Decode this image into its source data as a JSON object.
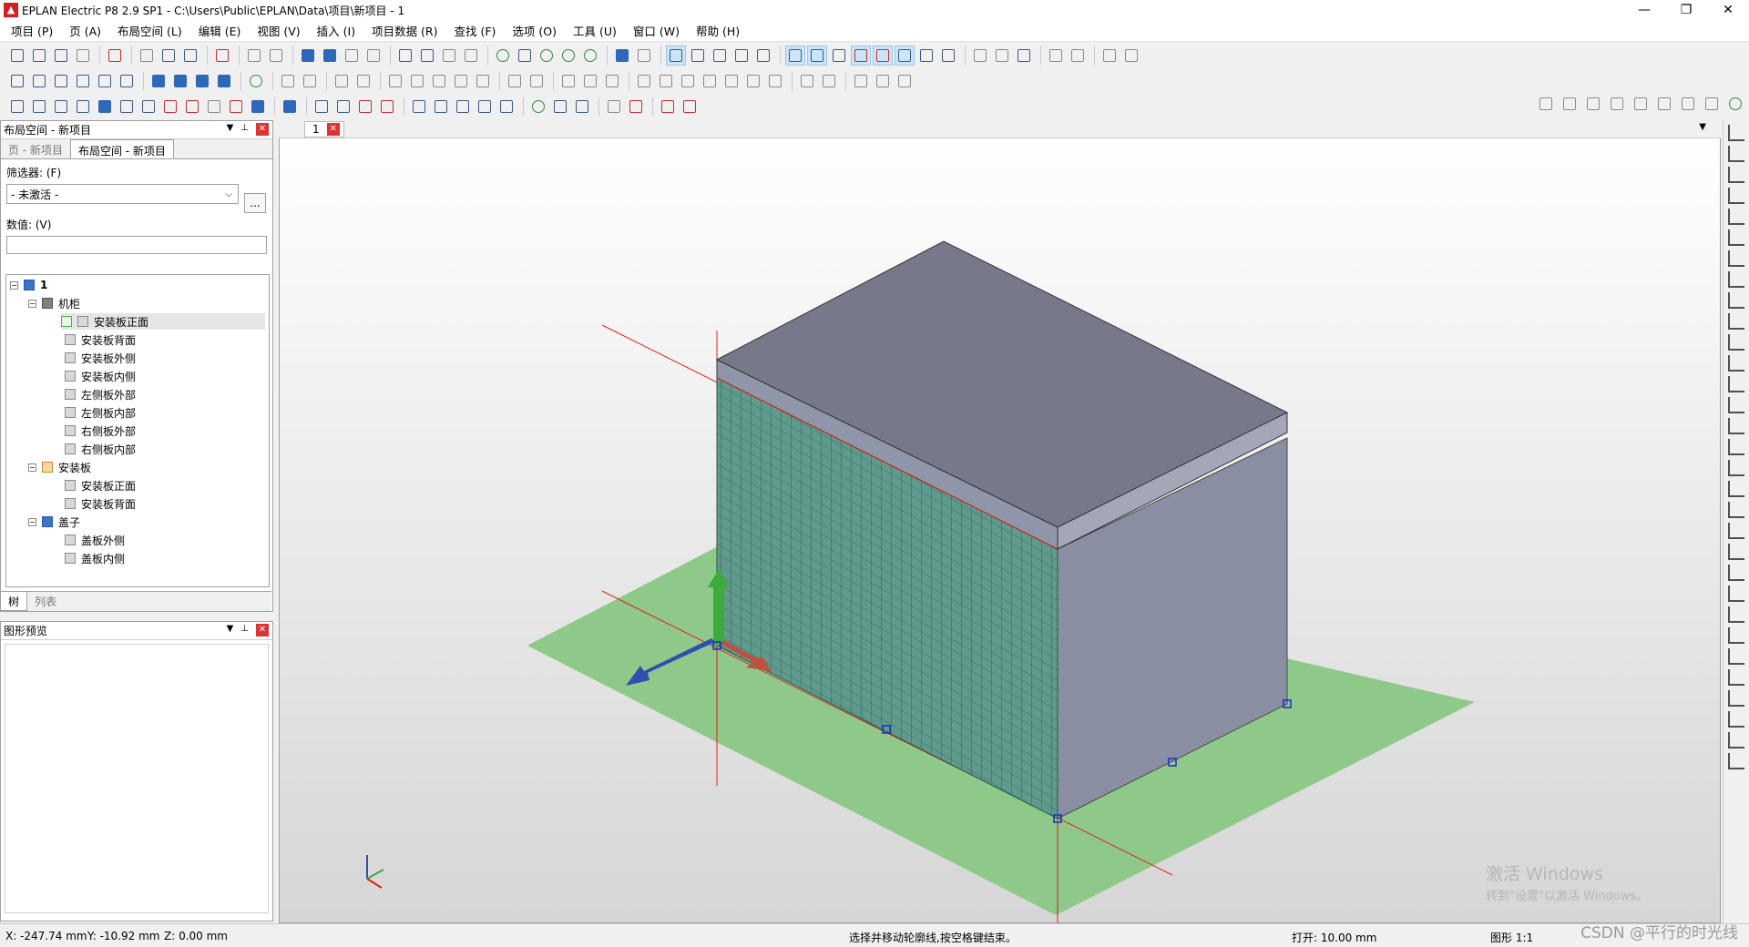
{
  "window": {
    "title": "EPLAN Electric P8 2.9 SP1 - C:\\Users\\Public\\EPLAN\\Data\\项目\\新项目 - 1"
  },
  "menu": [
    "项目 (P)",
    "页 (A)",
    "布局空间 (L)",
    "编辑 (E)",
    "视图 (V)",
    "插入 (I)",
    "项目数据 (R)",
    "查找 (F)",
    "选项 (O)",
    "工具 (U)",
    "窗口 (W)",
    "帮助 (H)"
  ],
  "layout_panel": {
    "title": "布局空间 - 新项目",
    "tabs": [
      "页 - 新项目",
      "布局空间 - 新项目"
    ],
    "filter_label": "筛选器: (F)",
    "filter_value": "- 未激活 -",
    "filter_button": "...",
    "value_label": "数值: (V)",
    "bottom_tabs": [
      "树",
      "列表"
    ]
  },
  "tree": {
    "root": "1",
    "groups": [
      {
        "label": "机柜",
        "items": [
          "安装板正面",
          "安装板背面",
          "安装板外侧",
          "安装板内侧",
          "左侧板外部",
          "左侧板内部",
          "右侧板外部",
          "右侧板内部"
        ]
      },
      {
        "label": "安装板",
        "items": [
          "安装板正面",
          "安装板背面"
        ]
      },
      {
        "label": "盖子",
        "items": [
          "盖板外侧",
          "盖板内侧"
        ]
      }
    ]
  },
  "preview_panel": {
    "title": "图形预览"
  },
  "viewport": {
    "tab_label": "1",
    "colors": {
      "floor": "#8ec98a",
      "cabinet_top": "#77798a",
      "cabinet_side": "#8a8ea2",
      "plate": "#5f9a8c",
      "axis_line": "#e02020"
    }
  },
  "status": {
    "x": "X: -247.74 mm",
    "y": "Y: -10.92 mm",
    "z": "Z: 0.00 mm",
    "hint": "选择并移动轮廓线,按空格键结束。",
    "open": "打开: 10.00 mm",
    "scale": "图形 1:1"
  },
  "watermark": {
    "line1": "激活 Windows",
    "line2": "转到\"设置\"以激活 Windows。",
    "csdn": "CSDN @平行的时光线"
  }
}
